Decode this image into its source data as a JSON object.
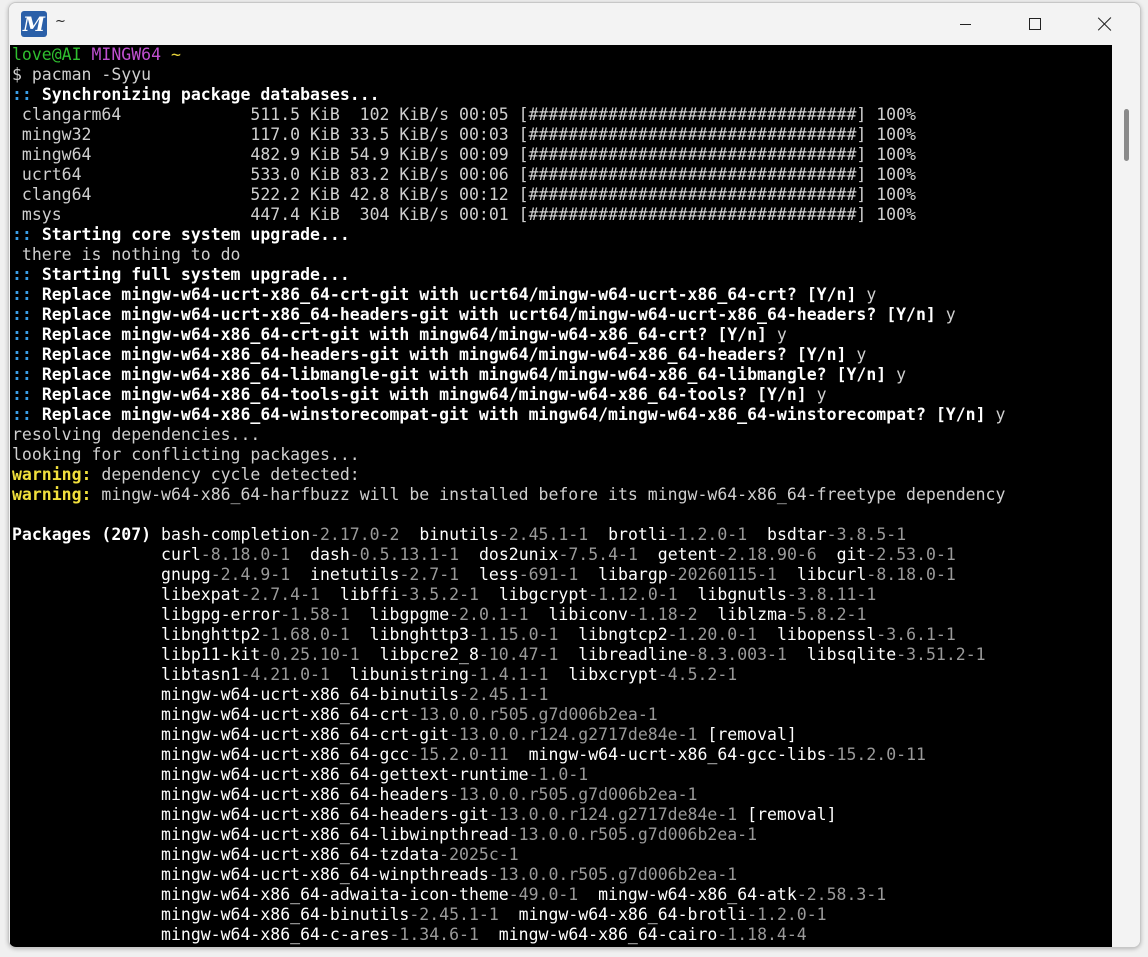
{
  "window": {
    "title": "~",
    "app_icon_letter": "M"
  },
  "prompt": {
    "user_host": "love@AI",
    "env": "MINGW64",
    "path": "~",
    "symbol": "$",
    "command": "pacman -Syyu"
  },
  "sync": {
    "header_marker": "::",
    "header": "Synchronizing package databases...",
    "rows": [
      {
        "name": "clangarm64",
        "size": "511.5 KiB",
        "speed": "102 KiB/s",
        "time": "00:05",
        "bar": "[#################################]",
        "pct": "100%"
      },
      {
        "name": "mingw32",
        "size": "117.0 KiB",
        "speed": "33.5 KiB/s",
        "time": "00:03",
        "bar": "[#################################]",
        "pct": "100%"
      },
      {
        "name": "mingw64",
        "size": "482.9 KiB",
        "speed": "54.9 KiB/s",
        "time": "00:09",
        "bar": "[#################################]",
        "pct": "100%"
      },
      {
        "name": "ucrt64",
        "size": "533.0 KiB",
        "speed": "83.2 KiB/s",
        "time": "00:06",
        "bar": "[#################################]",
        "pct": "100%"
      },
      {
        "name": "clang64",
        "size": "522.2 KiB",
        "speed": "42.8 KiB/s",
        "time": "00:12",
        "bar": "[#################################]",
        "pct": "100%"
      },
      {
        "name": "msys",
        "size": "447.4 KiB",
        "speed": "304 KiB/s",
        "time": "00:01",
        "bar": "[#################################]",
        "pct": "100%"
      }
    ]
  },
  "core": {
    "header": "Starting core system upgrade...",
    "note": " there is nothing to do"
  },
  "full": {
    "header": "Starting full system upgrade...",
    "replace": [
      {
        "text": "Replace mingw-w64-ucrt-x86_64-crt-git with ucrt64/mingw-w64-ucrt-x86_64-crt? [Y/n]",
        "answer": "y"
      },
      {
        "text": "Replace mingw-w64-ucrt-x86_64-headers-git with ucrt64/mingw-w64-ucrt-x86_64-headers? [Y/n]",
        "answer": "y"
      },
      {
        "text": "Replace mingw-w64-x86_64-crt-git with mingw64/mingw-w64-x86_64-crt? [Y/n]",
        "answer": "y"
      },
      {
        "text": "Replace mingw-w64-x86_64-headers-git with mingw64/mingw-w64-x86_64-headers? [Y/n]",
        "answer": "y"
      },
      {
        "text": "Replace mingw-w64-x86_64-libmangle-git with mingw64/mingw-w64-x86_64-libmangle? [Y/n]",
        "answer": "y"
      },
      {
        "text": "Replace mingw-w64-x86_64-tools-git with mingw64/mingw-w64-x86_64-tools? [Y/n]",
        "answer": "y"
      },
      {
        "text": "Replace mingw-w64-x86_64-winstorecompat-git with mingw64/mingw-w64-x86_64-winstorecompat? [Y/n]",
        "answer": "y"
      }
    ]
  },
  "resolving": "resolving dependencies...",
  "conflicts": "looking for conflicting packages...",
  "warnings": [
    {
      "label": "warning:",
      "text": " dependency cycle detected:"
    },
    {
      "label": "warning:",
      "text": " mingw-w64-x86_64-harfbuzz will be installed before its mingw-w64-x86_64-freetype dependency"
    }
  ],
  "packages": {
    "label": "Packages (207)",
    "lines": [
      [
        [
          "bash-completion",
          "-2.17.0-2"
        ],
        [
          "binutils",
          "-2.45.1-1"
        ],
        [
          "brotli",
          "-1.2.0-1"
        ],
        [
          "bsdtar",
          "-3.8.5-1"
        ]
      ],
      [
        [
          "curl",
          "-8.18.0-1"
        ],
        [
          "dash",
          "-0.5.13.1-1"
        ],
        [
          "dos2unix",
          "-7.5.4-1"
        ],
        [
          "getent",
          "-2.18.90-6"
        ],
        [
          "git",
          "-2.53.0-1"
        ]
      ],
      [
        [
          "gnupg",
          "-2.4.9-1"
        ],
        [
          "inetutils",
          "-2.7-1"
        ],
        [
          "less",
          "-691-1"
        ],
        [
          "libargp",
          "-20260115-1"
        ],
        [
          "libcurl",
          "-8.18.0-1"
        ]
      ],
      [
        [
          "libexpat",
          "-2.7.4-1"
        ],
        [
          "libffi",
          "-3.5.2-1"
        ],
        [
          "libgcrypt",
          "-1.12.0-1"
        ],
        [
          "libgnutls",
          "-3.8.11-1"
        ]
      ],
      [
        [
          "libgpg-error",
          "-1.58-1"
        ],
        [
          "libgpgme",
          "-2.0.1-1"
        ],
        [
          "libiconv",
          "-1.18-2"
        ],
        [
          "liblzma",
          "-5.8.2-1"
        ]
      ],
      [
        [
          "libnghttp2",
          "-1.68.0-1"
        ],
        [
          "libnghttp3",
          "-1.15.0-1"
        ],
        [
          "libngtcp2",
          "-1.20.0-1"
        ],
        [
          "libopenssl",
          "-3.6.1-1"
        ]
      ],
      [
        [
          "libp11-kit",
          "-0.25.10-1"
        ],
        [
          "libpcre2_8",
          "-10.47-1"
        ],
        [
          "libreadline",
          "-8.3.003-1"
        ],
        [
          "libsqlite",
          "-3.51.2-1"
        ]
      ],
      [
        [
          "libtasn1",
          "-4.21.0-1"
        ],
        [
          "libunistring",
          "-1.4.1-1"
        ],
        [
          "libxcrypt",
          "-4.5.2-1"
        ]
      ],
      [
        [
          "mingw-w64-ucrt-x86_64-binutils",
          "-2.45.1-1"
        ]
      ],
      [
        [
          "mingw-w64-ucrt-x86_64-crt",
          "-13.0.0.r505.g7d006b2ea-1"
        ]
      ],
      [
        [
          "mingw-w64-ucrt-x86_64-crt-git",
          "-13.0.0.r124.g2717de84e-1",
          " [removal]"
        ]
      ],
      [
        [
          "mingw-w64-ucrt-x86_64-gcc",
          "-15.2.0-11"
        ],
        [
          "mingw-w64-ucrt-x86_64-gcc-libs",
          "-15.2.0-11"
        ]
      ],
      [
        [
          "mingw-w64-ucrt-x86_64-gettext-runtime",
          "-1.0-1"
        ]
      ],
      [
        [
          "mingw-w64-ucrt-x86_64-headers",
          "-13.0.0.r505.g7d006b2ea-1"
        ]
      ],
      [
        [
          "mingw-w64-ucrt-x86_64-headers-git",
          "-13.0.0.r124.g2717de84e-1",
          " [removal]"
        ]
      ],
      [
        [
          "mingw-w64-ucrt-x86_64-libwinpthread",
          "-13.0.0.r505.g7d006b2ea-1"
        ]
      ],
      [
        [
          "mingw-w64-ucrt-x86_64-tzdata",
          "-2025c-1"
        ]
      ],
      [
        [
          "mingw-w64-ucrt-x86_64-winpthreads",
          "-13.0.0.r505.g7d006b2ea-1"
        ]
      ],
      [
        [
          "mingw-w64-x86_64-adwaita-icon-theme",
          "-49.0-1"
        ],
        [
          "mingw-w64-x86_64-atk",
          "-2.58.3-1"
        ]
      ],
      [
        [
          "mingw-w64-x86_64-binutils",
          "-2.45.1-1"
        ],
        [
          "mingw-w64-x86_64-brotli",
          "-1.2.0-1"
        ]
      ],
      [
        [
          "mingw-w64-x86_64-c-ares",
          "-1.34.6-1"
        ],
        [
          "mingw-w64-x86_64-cairo",
          "-1.18.4-4"
        ]
      ]
    ]
  }
}
